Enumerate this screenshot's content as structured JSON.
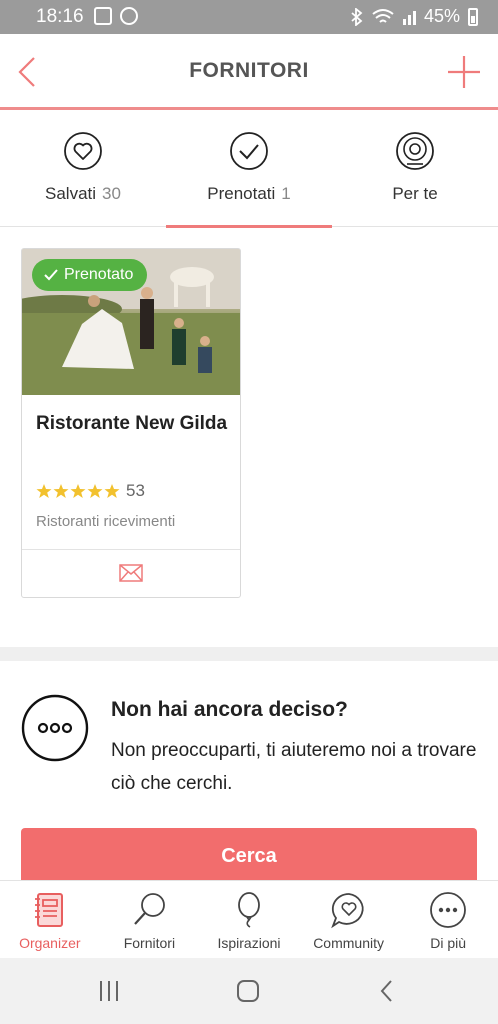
{
  "status": {
    "time": "18:16",
    "battery": "45%"
  },
  "header": {
    "title": "FORNITORI"
  },
  "tabs": [
    {
      "label": "Salvati",
      "count": "30",
      "icon": "heart-icon"
    },
    {
      "label": "Prenotati",
      "count": "1",
      "icon": "check-icon"
    },
    {
      "label": "Per te",
      "count": "",
      "icon": "target-icon"
    }
  ],
  "card": {
    "badge": "Prenotato",
    "name": "Ristorante New Gilda",
    "rating_count": "53",
    "stars": 5,
    "category": "Ristoranti ricevimenti"
  },
  "undecided": {
    "title": "Non hai ancora deciso?",
    "text": "Non preoccuparti, ti aiuteremo noi a trovare ciò che cerchi."
  },
  "cta": {
    "label": "Cerca"
  },
  "bottom_nav": [
    {
      "label": "Organizer",
      "icon": "notebook-icon"
    },
    {
      "label": "Fornitori",
      "icon": "magnifier-icon"
    },
    {
      "label": "Ispirazioni",
      "icon": "balloon-icon"
    },
    {
      "label": "Community",
      "icon": "chat-heart-icon"
    },
    {
      "label": "Di più",
      "icon": "more-icon"
    }
  ],
  "colors": {
    "accent": "#f26d6d",
    "booked": "#55b243",
    "star": "#f2c12e"
  }
}
